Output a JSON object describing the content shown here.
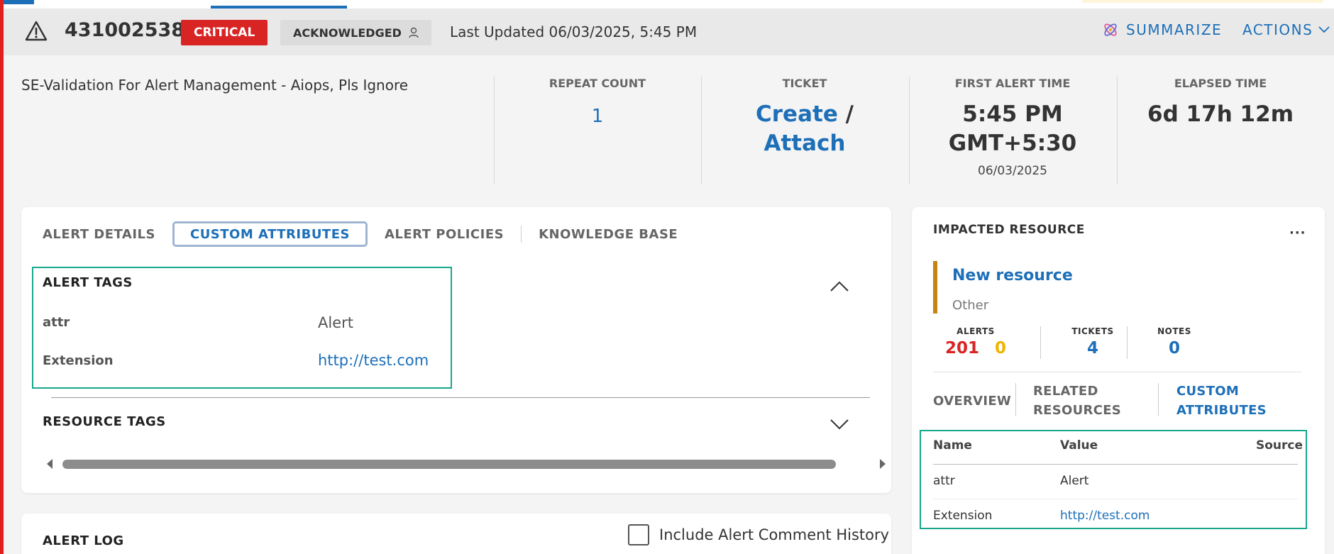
{
  "header": {
    "alert_id": "431002538",
    "severity": "CRITICAL",
    "state": "ACKNOWLEDGED",
    "last_updated": "Last Updated 06/03/2025, 5:45 PM",
    "summarize_label": "SUMMARIZE",
    "actions_label": "ACTIONS"
  },
  "summary": {
    "title": "SE-Validation For Alert Management - Aiops, Pls Ignore",
    "repeat_count_label": "REPEAT COUNT",
    "repeat_count": "1",
    "ticket_label": "TICKET",
    "ticket_create": "Create",
    "ticket_slash": " /",
    "ticket_attach": "Attach",
    "first_alert_label": "FIRST ALERT TIME",
    "first_alert_time": "5:45 PM",
    "first_alert_tz": "GMT+5:30",
    "first_alert_date": "06/03/2025",
    "elapsed_label": "ELAPSED TIME",
    "elapsed": "6d 17h 12m"
  },
  "tabs": [
    "ALERT DETAILS",
    "CUSTOM ATTRIBUTES",
    "ALERT POLICIES",
    "KNOWLEDGE BASE"
  ],
  "alert_tags": {
    "title": "ALERT TAGS",
    "rows": [
      {
        "key": "attr",
        "value": "Alert"
      },
      {
        "key": "Extension",
        "value": "http://test.com"
      }
    ]
  },
  "resource_tags": {
    "title": "RESOURCE TAGS"
  },
  "alert_log": {
    "title": "ALERT LOG",
    "include_history_label": "Include Alert Comment History",
    "include_history_checked": false
  },
  "impacted_resource": {
    "title": "IMPACTED RESOURCE",
    "more": "···",
    "name": "New resource",
    "type": "Other",
    "alerts_label": "ALERTS",
    "alerts_critical": "201",
    "alerts_warning": "0",
    "tickets_label": "TICKETS",
    "tickets": "4",
    "notes_label": "NOTES",
    "notes": "0",
    "tabs": {
      "overview": "OVERVIEW",
      "related_1": "RELATED",
      "related_2": "RESOURCES",
      "custom_1": "CUSTOM",
      "custom_2": "ATTRIBUTES"
    },
    "table": {
      "headers": [
        "Name",
        "Value",
        "Source"
      ],
      "rows": [
        {
          "name": "attr",
          "value": "Alert",
          "source": ""
        },
        {
          "name": "Extension",
          "value": "http://test.com",
          "source": ""
        }
      ]
    }
  },
  "colors": {
    "accent": "#1d6fb8",
    "critical": "#d92424",
    "warning": "#f0b400",
    "highlight_box": "#17a88b",
    "resource_bar": "#c48512"
  },
  "icons": [
    "warning-triangle-icon",
    "person-icon",
    "summarize-ai-icon",
    "chevron-down-icon",
    "chevron-up-icon"
  ]
}
